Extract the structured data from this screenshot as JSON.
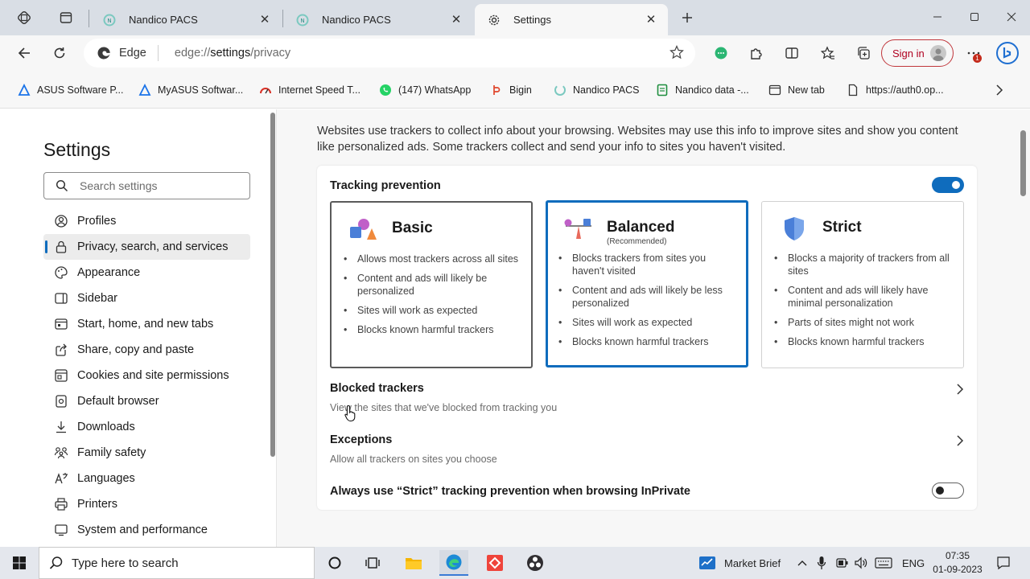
{
  "tabs": [
    {
      "title": "Nandico PACS"
    },
    {
      "title": "Nandico PACS"
    },
    {
      "title": "Settings"
    }
  ],
  "toolbar": {
    "site_label": "Edge",
    "url_host": "edge://",
    "url_bold": "settings",
    "url_path": "/privacy",
    "signin": "Sign in",
    "notification_count": "1"
  },
  "bookmarks": [
    "ASUS Software P...",
    "MyASUS Softwar...",
    "Internet Speed T...",
    "(147) WhatsApp",
    "Bigin",
    "Nandico PACS",
    "Nandico data -...",
    "New tab",
    "https://auth0.op..."
  ],
  "sidebar": {
    "title": "Settings",
    "search_placeholder": "Search settings",
    "items": [
      {
        "label": "Profiles",
        "icon": "profile-icon"
      },
      {
        "label": "Privacy, search, and services",
        "icon": "lock-icon",
        "selected": true
      },
      {
        "label": "Appearance",
        "icon": "appearance-icon"
      },
      {
        "label": "Sidebar",
        "icon": "sidebar-icon"
      },
      {
        "label": "Start, home, and new tabs",
        "icon": "home-icon"
      },
      {
        "label": "Share, copy and paste",
        "icon": "share-icon"
      },
      {
        "label": "Cookies and site permissions",
        "icon": "cookies-icon"
      },
      {
        "label": "Default browser",
        "icon": "browser-icon"
      },
      {
        "label": "Downloads",
        "icon": "download-icon"
      },
      {
        "label": "Family safety",
        "icon": "family-icon"
      },
      {
        "label": "Languages",
        "icon": "languages-icon"
      },
      {
        "label": "Printers",
        "icon": "printer-icon"
      },
      {
        "label": "System and performance",
        "icon": "system-icon"
      }
    ]
  },
  "main": {
    "description": "Websites use trackers to collect info about your browsing. Websites may use this info to improve sites and show you content like personalized ads. Some trackers collect and send your info to sites you haven't visited.",
    "tracking_title": "Tracking prevention",
    "tracking_enabled": true,
    "options": [
      {
        "name": "Basic",
        "recommended": "",
        "bullets": [
          "Allows most trackers across all sites",
          "Content and ads will likely be personalized",
          "Sites will work as expected",
          "Blocks known harmful trackers"
        ]
      },
      {
        "name": "Balanced",
        "recommended": "(Recommended)",
        "selected": true,
        "bullets": [
          "Blocks trackers from sites you haven't visited",
          "Content and ads will likely be less personalized",
          "Sites will work as expected",
          "Blocks known harmful trackers"
        ]
      },
      {
        "name": "Strict",
        "recommended": "",
        "bullets": [
          "Blocks a majority of trackers from all sites",
          "Content and ads will likely have minimal personalization",
          "Parts of sites might not work",
          "Blocks known harmful trackers"
        ]
      }
    ],
    "blocked_title": "Blocked trackers",
    "blocked_sub": "View the sites that we've blocked from tracking you",
    "exceptions_title": "Exceptions",
    "exceptions_sub": "Allow all trackers on sites you choose",
    "inprivate_title": "Always use “Strict” tracking prevention when browsing InPrivate",
    "inprivate_enabled": false
  },
  "taskbar": {
    "search_placeholder": "Type here to search",
    "market": "Market Brief",
    "lang": "ENG",
    "time": "07:35",
    "date": "01-09-2023"
  },
  "colors": {
    "accent": "#0f6cbd",
    "signin_border": "#c0363b"
  }
}
